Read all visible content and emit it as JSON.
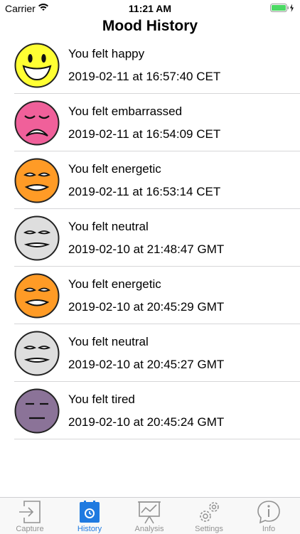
{
  "status_bar": {
    "carrier": "Carrier",
    "time": "11:21 AM",
    "battery_color": "#4cd964"
  },
  "nav": {
    "title": "Mood History"
  },
  "entries": [
    {
      "mood": "happy",
      "title": "You felt happy",
      "date": "2019-02-11 at 16:57:40 CET",
      "color": "#ffff33",
      "face_icon": "happy-face-icon"
    },
    {
      "mood": "embarrassed",
      "title": "You felt embarrassed",
      "date": "2019-02-11 at 16:54:09 CET",
      "color": "#f0609a",
      "face_icon": "embarrassed-face-icon"
    },
    {
      "mood": "energetic",
      "title": "You felt energetic",
      "date": "2019-02-11 at 16:53:14 CET",
      "color": "#ff9b26",
      "face_icon": "energetic-face-icon"
    },
    {
      "mood": "neutral",
      "title": "You felt neutral",
      "date": "2019-02-10 at 21:48:47 GMT",
      "color": "#dedede",
      "face_icon": "neutral-face-icon"
    },
    {
      "mood": "energetic",
      "title": "You felt energetic",
      "date": "2019-02-10 at 20:45:29 GMT",
      "color": "#ff9b26",
      "face_icon": "energetic-face-icon"
    },
    {
      "mood": "neutral",
      "title": "You felt neutral",
      "date": "2019-02-10 at 20:45:27 GMT",
      "color": "#dedede",
      "face_icon": "neutral-face-icon"
    },
    {
      "mood": "tired",
      "title": "You felt tired",
      "date": "2019-02-10 at 20:45:24 GMT",
      "color": "#8b7398",
      "face_icon": "tired-face-icon"
    }
  ],
  "tab_bar": {
    "active_color": "#1f7ae0",
    "inactive_color": "#929292",
    "tabs": [
      {
        "label": "Capture",
        "icon": "capture-icon",
        "active": false
      },
      {
        "label": "History",
        "icon": "history-icon",
        "active": true
      },
      {
        "label": "Analysis",
        "icon": "analysis-icon",
        "active": false
      },
      {
        "label": "Settings",
        "icon": "settings-icon",
        "active": false
      },
      {
        "label": "Info",
        "icon": "info-icon",
        "active": false
      }
    ]
  }
}
